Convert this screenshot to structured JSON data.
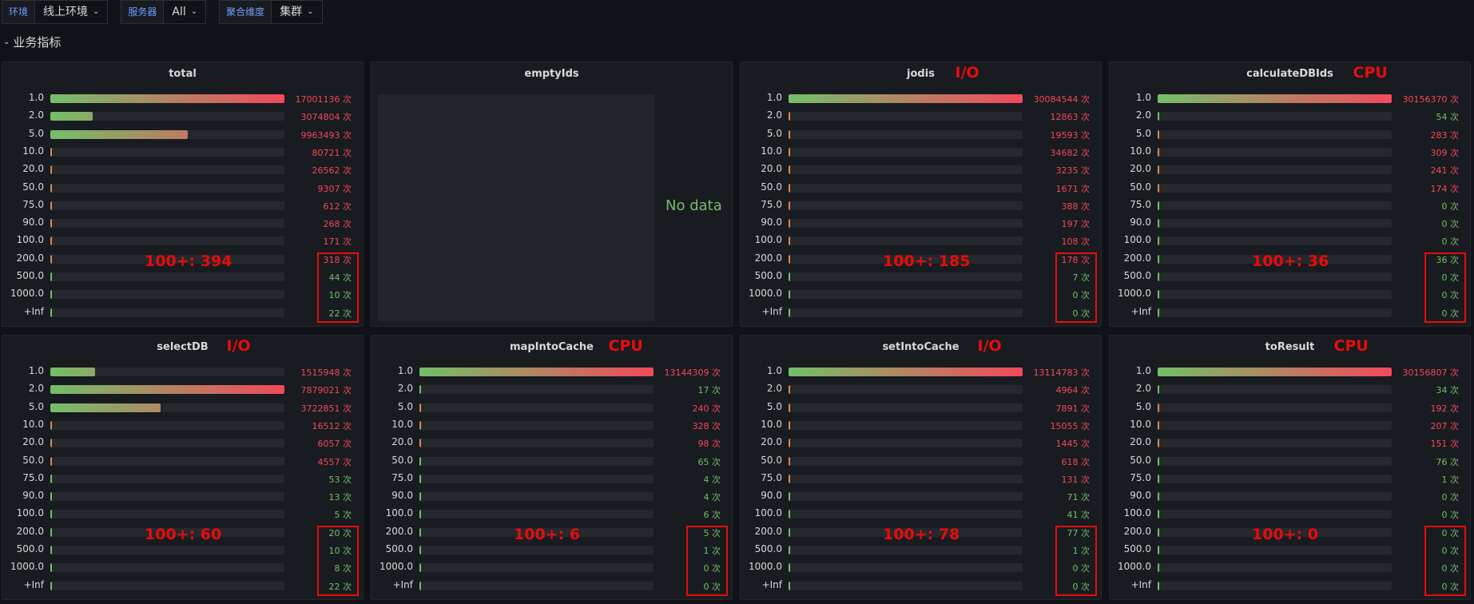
{
  "vars": [
    {
      "label": "环境",
      "value": "线上环境"
    },
    {
      "label": "服务器",
      "value": "All"
    },
    {
      "label": "聚合维度",
      "value": "集群"
    }
  ],
  "row_title": "业务指标",
  "colors": {
    "low": "#73bf69",
    "high": "#f2495c",
    "track": "#25282d"
  },
  "no_data_text": "No data",
  "unit": "次",
  "buckets": [
    "1.0",
    "2.0",
    "5.0",
    "10.0",
    "20.0",
    "50.0",
    "75.0",
    "90.0",
    "100.0",
    "200.0",
    "500.0",
    "1000.0",
    "+Inf"
  ],
  "panels": [
    {
      "title": "total",
      "tag": "",
      "summary": "100+: 394",
      "values": [
        "17001136 次",
        "3074804 次",
        "9963493 次",
        "80721 次",
        "26562 次",
        "9307 次",
        "612 次",
        "268 次",
        "171 次",
        "318 次",
        "44 次",
        "10 次",
        "22 次"
      ],
      "fill": [
        1.0,
        0.181,
        0.586,
        0.0047,
        0.0016,
        0.0005,
        0,
        0,
        0,
        0,
        0,
        0,
        0
      ],
      "high": [
        true,
        true,
        true,
        true,
        true,
        true,
        true,
        true,
        true,
        true,
        false,
        false,
        false
      ]
    },
    {
      "title": "emptyIds",
      "tag": "",
      "summary": "",
      "nodata": true
    },
    {
      "title": "jodis",
      "tag": "I/O",
      "summary": "100+: 185",
      "values": [
        "30084544 次",
        "12863 次",
        "19593 次",
        "34682 次",
        "3235 次",
        "1671 次",
        "388 次",
        "197 次",
        "108 次",
        "178 次",
        "7 次",
        "0 次",
        "0 次"
      ],
      "fill": [
        1.0,
        0,
        0,
        0,
        0,
        0,
        0,
        0,
        0,
        0,
        0,
        0,
        0
      ],
      "high": [
        true,
        true,
        true,
        true,
        true,
        true,
        true,
        true,
        true,
        true,
        false,
        false,
        false
      ]
    },
    {
      "title": "calculateDBIds",
      "tag": "CPU",
      "summary": "100+: 36",
      "values": [
        "30156370 次",
        "54 次",
        "283 次",
        "309 次",
        "241 次",
        "174 次",
        "0 次",
        "0 次",
        "0 次",
        "36 次",
        "0 次",
        "0 次",
        "0 次"
      ],
      "fill": [
        1.0,
        0,
        0,
        0,
        0,
        0,
        0,
        0,
        0,
        0,
        0,
        0,
        0
      ],
      "high": [
        true,
        false,
        true,
        true,
        true,
        true,
        false,
        false,
        false,
        false,
        false,
        false,
        false
      ]
    },
    {
      "title": "selectDB",
      "tag": "I/O",
      "summary": "100+: 60",
      "values": [
        "1515948 次",
        "7879021 次",
        "3722851 次",
        "16512 次",
        "6057 次",
        "4557 次",
        "53 次",
        "13 次",
        "5 次",
        "20 次",
        "10 次",
        "8 次",
        "22 次"
      ],
      "fill": [
        0.192,
        1.0,
        0.472,
        0.002,
        0,
        0,
        0,
        0,
        0,
        0,
        0,
        0,
        0
      ],
      "high": [
        true,
        true,
        true,
        true,
        true,
        true,
        false,
        false,
        false,
        false,
        false,
        false,
        false
      ]
    },
    {
      "title": "mapIntoCache",
      "tag": "CPU",
      "summary": "100+: 6",
      "values": [
        "13144309 次",
        "17 次",
        "240 次",
        "328 次",
        "98 次",
        "65 次",
        "4 次",
        "4 次",
        "6 次",
        "5 次",
        "1 次",
        "0 次",
        "0 次"
      ],
      "fill": [
        1.0,
        0,
        0,
        0,
        0,
        0,
        0,
        0,
        0,
        0,
        0,
        0,
        0
      ],
      "high": [
        true,
        false,
        true,
        true,
        true,
        false,
        false,
        false,
        false,
        false,
        false,
        false,
        false
      ]
    },
    {
      "title": "setIntoCache",
      "tag": "I/O",
      "summary": "100+: 78",
      "values": [
        "13114783 次",
        "4964 次",
        "7891 次",
        "15055 次",
        "1445 次",
        "618 次",
        "131 次",
        "71 次",
        "41 次",
        "77 次",
        "1 次",
        "0 次",
        "0 次"
      ],
      "fill": [
        1.0,
        0,
        0,
        0,
        0,
        0,
        0,
        0,
        0,
        0,
        0,
        0,
        0
      ],
      "high": [
        true,
        true,
        true,
        true,
        true,
        true,
        true,
        false,
        false,
        false,
        false,
        false,
        false
      ]
    },
    {
      "title": "toResult",
      "tag": "CPU",
      "summary": "100+: 0",
      "values": [
        "30156807 次",
        "34 次",
        "192 次",
        "207 次",
        "151 次",
        "76 次",
        "1 次",
        "0 次",
        "0 次",
        "0 次",
        "0 次",
        "0 次",
        "0 次"
      ],
      "fill": [
        1.0,
        0,
        0,
        0,
        0,
        0,
        0,
        0,
        0,
        0,
        0,
        0,
        0
      ],
      "high": [
        true,
        false,
        true,
        true,
        true,
        false,
        false,
        false,
        false,
        false,
        false,
        false,
        false
      ]
    }
  ]
}
